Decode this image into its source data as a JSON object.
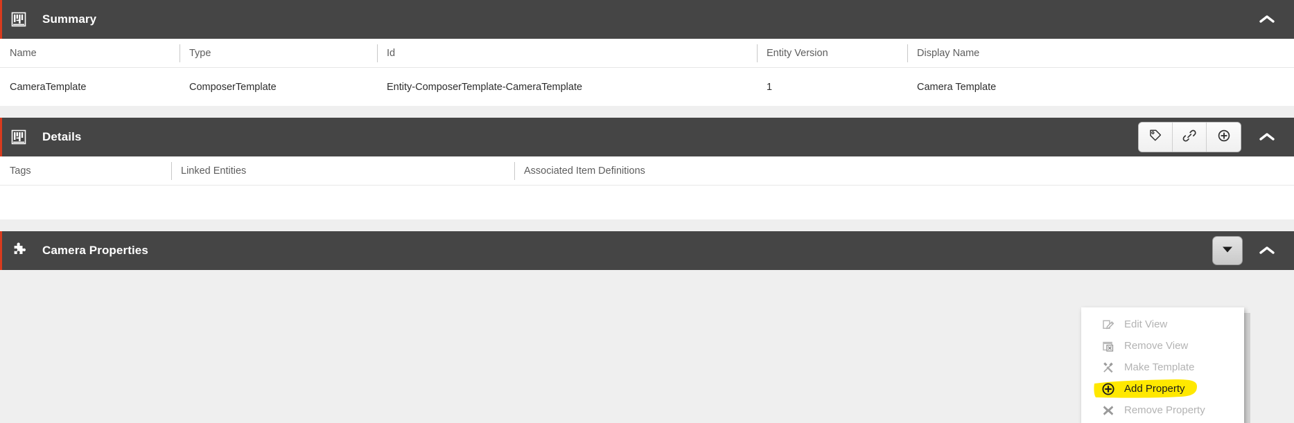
{
  "theme": {
    "header_bg": "#454545",
    "accent_red": "#d93b1e",
    "page_bg": "#efefef",
    "highlight_yellow": "#ffe800"
  },
  "summary": {
    "title": "Summary",
    "icon": "table-grid-icon",
    "collapse_icon": "chevron-up-icon",
    "columns": [
      "Name",
      "Type",
      "Id",
      "Entity Version",
      "Display Name"
    ],
    "rows": [
      {
        "name": "CameraTemplate",
        "type": "ComposerTemplate",
        "id": "Entity-ComposerTemplate-CameraTemplate",
        "entity_version": "1",
        "display_name": "Camera Template"
      }
    ]
  },
  "details": {
    "title": "Details",
    "icon": "table-grid-icon",
    "collapse_icon": "chevron-up-icon",
    "actions": [
      {
        "name": "tag-icon",
        "label": "Tag"
      },
      {
        "name": "link-icon",
        "label": "Link"
      },
      {
        "name": "plus-circle-icon",
        "label": "Add"
      }
    ],
    "columns": [
      "Tags",
      "Linked Entities",
      "Associated Item Definitions"
    ],
    "rows": [
      {
        "tags": "",
        "linked_entities": "",
        "associated_item_definitions": ""
      }
    ]
  },
  "camera_properties": {
    "title": "Camera Properties",
    "icon": "puzzle-piece-icon",
    "dropdown_icon": "caret-down-icon",
    "collapse_icon": "chevron-up-icon",
    "menu": [
      {
        "label": "Edit View",
        "icon": "edit-view-icon",
        "enabled": false,
        "highlighted": false
      },
      {
        "label": "Remove View",
        "icon": "remove-view-icon",
        "enabled": false,
        "highlighted": false
      },
      {
        "label": "Make Template",
        "icon": "make-template-icon",
        "enabled": false,
        "highlighted": false
      },
      {
        "label": "Add Property",
        "icon": "plus-circle-icon",
        "enabled": true,
        "highlighted": true
      },
      {
        "label": "Remove Property",
        "icon": "remove-property-icon",
        "enabled": false,
        "highlighted": false
      }
    ]
  }
}
